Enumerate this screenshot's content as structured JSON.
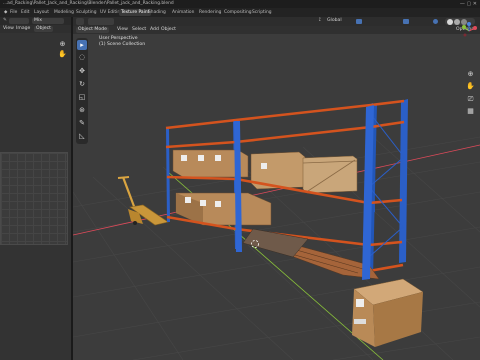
{
  "window": {
    "title": "...ad_Racking\\Pallet_Jack_and_Racking\\Blender\\Pallet_jack_and_Racking.blend"
  },
  "workspace_tabs": [
    {
      "label": "Layout",
      "active": false
    },
    {
      "label": "Modeling",
      "active": false
    },
    {
      "label": "Sculpting",
      "active": false
    },
    {
      "label": "UV Editing",
      "active": false
    },
    {
      "label": "Texture Paint",
      "active": true
    },
    {
      "label": "Shading",
      "active": false
    },
    {
      "label": "Animation",
      "active": false
    },
    {
      "label": "Rendering",
      "active": false
    },
    {
      "label": "Compositing",
      "active": false
    },
    {
      "label": "Scripting",
      "active": false
    }
  ],
  "left_editor": {
    "mode_value": "Mix",
    "header_labels": [
      "View",
      "Image",
      "Object"
    ]
  },
  "viewport_header": {
    "mode": "Object Mode",
    "menu": [
      "View",
      "Select",
      "Add",
      "Object"
    ],
    "transform_orientation": "Global",
    "options_label": "Options"
  },
  "viewport_overlay": {
    "perspective": "User Perspective",
    "collection": "(1) Scene Collection"
  },
  "colors": {
    "accent": "#4772b3",
    "rack_upright": "#2b5fc7",
    "rack_beam": "#d4531e",
    "axis_x": "#e04a5a",
    "axis_y": "#8ac33a",
    "axis_z": "#4a84e0",
    "pallet_jack": "#d9a441"
  },
  "icons": {
    "tools": [
      "cursor-icon",
      "select-box-icon",
      "move-icon",
      "rotate-icon",
      "scale-icon",
      "transform-icon",
      "annotate-icon",
      "measure-icon"
    ],
    "nav": [
      "zoom-icon",
      "hand-pan-icon",
      "camera-icon",
      "grid-view-icon"
    ]
  }
}
